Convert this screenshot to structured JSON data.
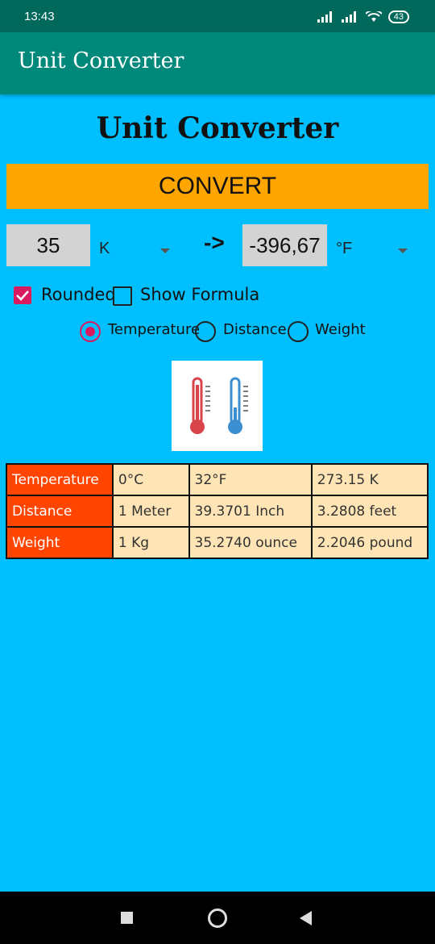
{
  "status_bar": {
    "time": "13:43",
    "battery": "43"
  },
  "app_bar": {
    "title": "Unit Converter"
  },
  "heading": "Unit Converter",
  "convert_button": "CONVERT",
  "converter": {
    "input_value": "35",
    "input_unit": "K",
    "arrow": "->",
    "output_value": "-396,67",
    "output_unit": "°F"
  },
  "options": {
    "rounded": {
      "label": "Rounded",
      "checked": true
    },
    "show_formula": {
      "label": "Show Formula",
      "checked": false
    }
  },
  "categories": [
    {
      "label": "Temperature",
      "selected": true
    },
    {
      "label": "Distance",
      "selected": false
    },
    {
      "label": "Weight",
      "selected": false
    }
  ],
  "image": {
    "icon": "thermometer-icon",
    "colors": [
      "#D9434A",
      "#3B8FD0"
    ]
  },
  "table": [
    [
      "Temperature",
      "0°C",
      "32°F",
      "273.15 K"
    ],
    [
      "Distance",
      "1 Meter",
      "39.3701 Inch",
      "3.2808 feet"
    ],
    [
      "Weight",
      "1 Kg",
      "35.2740 ounce",
      "2.2046 pound"
    ]
  ],
  "colors": {
    "background": "#00BFFF",
    "app_bar": "#00897B",
    "status_bar": "#00695C",
    "button": "#FFA500",
    "accent": "#D81B60",
    "table_header": "#FF4500",
    "table_cell": "#FFE4B5"
  }
}
